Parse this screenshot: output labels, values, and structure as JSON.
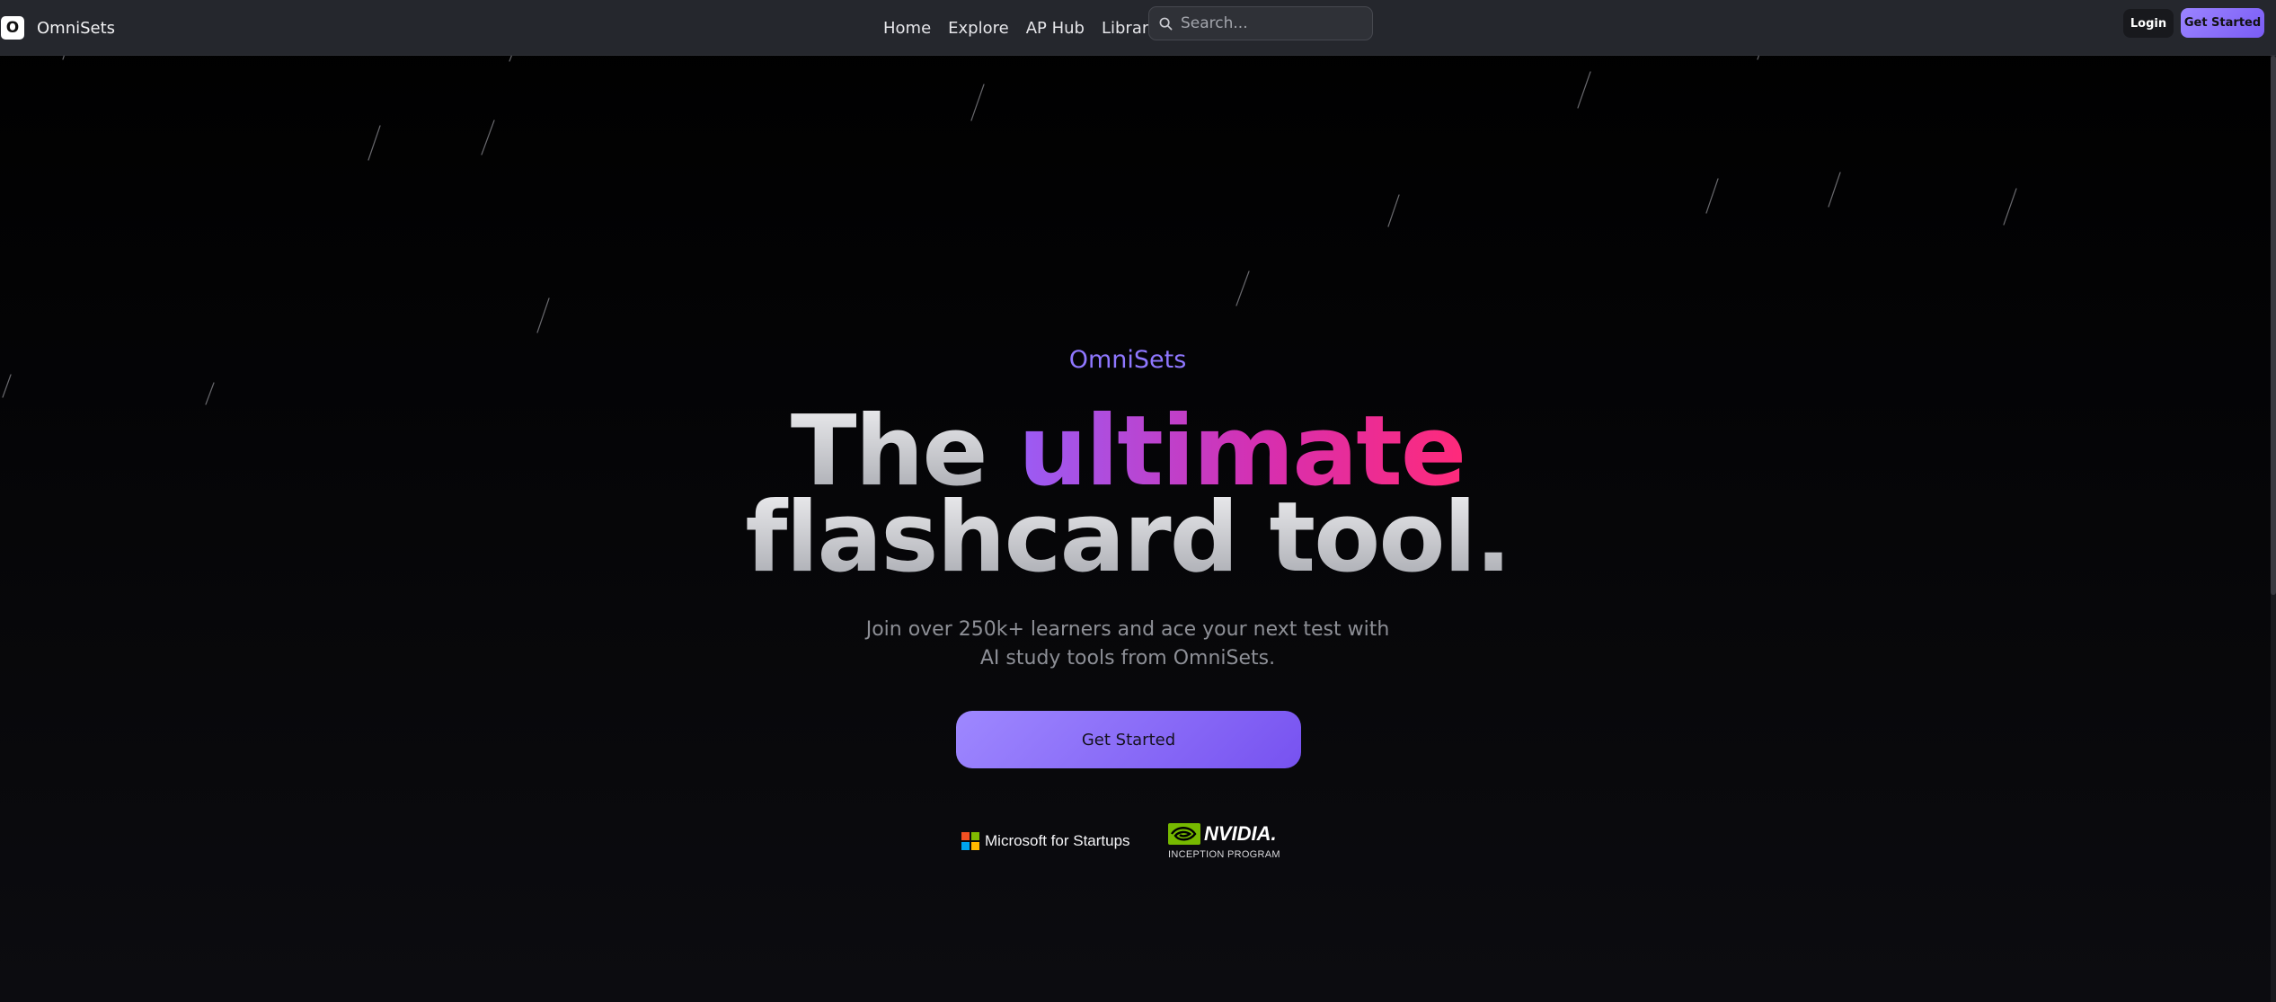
{
  "app": {
    "brand_initial": "O",
    "brand_name": "OmniSets"
  },
  "nav": {
    "links": [
      "Home",
      "Explore",
      "AP Hub",
      "Library"
    ],
    "search_placeholder": "Search...",
    "login_label": "Login",
    "get_started_label": "Get Started"
  },
  "hero": {
    "eyebrow": "OmniSets",
    "title_part1": "The ",
    "title_highlight": "ultimate",
    "title_part2": "flashcard tool.",
    "subtitle_line1": "Join over 250k+ learners and ace your next test with",
    "subtitle_line2": "AI study tools from OmniSets.",
    "cta_label": "Get Started"
  },
  "partners": {
    "microsoft": "Microsoft for Startups",
    "nvidia_word": "NVIDIA.",
    "nvidia_sub": "INCEPTION PROGRAM"
  },
  "colors": {
    "accent": "#8f77ff",
    "highlight_start": "#9a5cf5",
    "highlight_end": "#ff2a7a",
    "nvidia_green": "#76b900"
  },
  "icons": [
    "search-icon",
    "microsoft-logo-icon",
    "nvidia-eye-icon"
  ]
}
